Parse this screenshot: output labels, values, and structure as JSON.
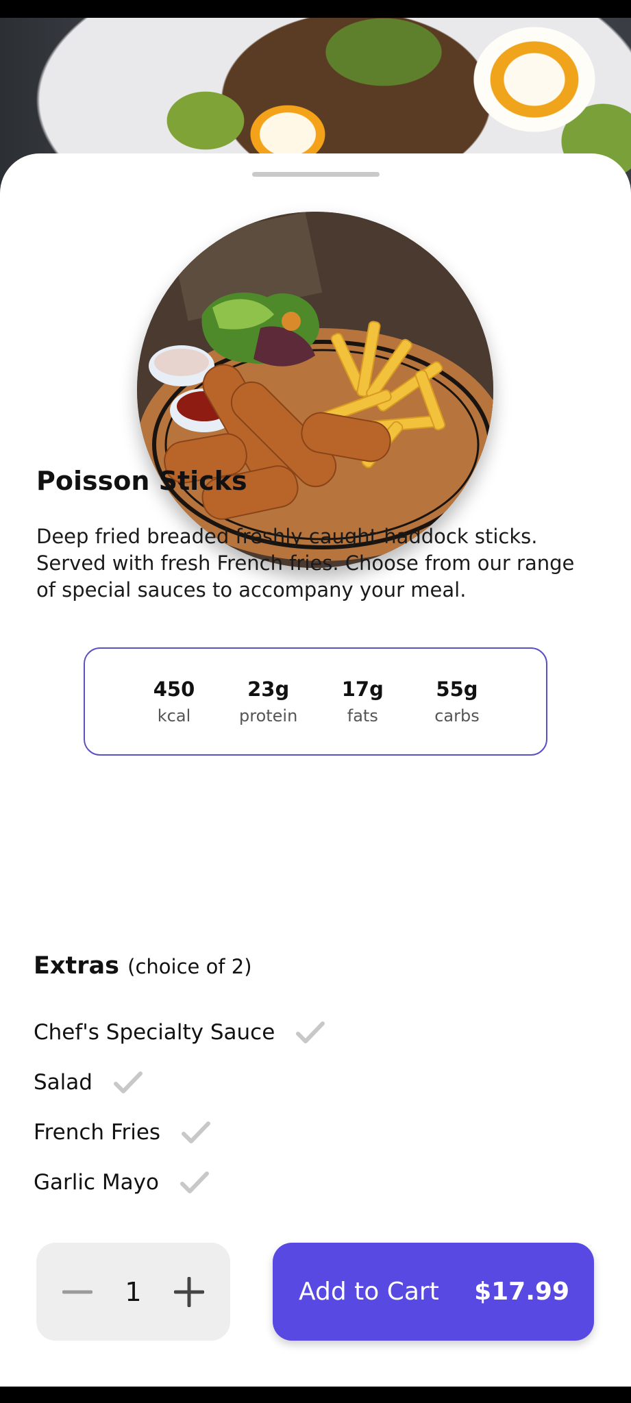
{
  "dish": {
    "title": "Poisson Sticks",
    "description": "Deep fried breaded freshly caught haddock sticks. Served with fresh French fries. Choose from our range of special sauces to accompany your meal."
  },
  "nutrition": [
    {
      "value": "450",
      "unit": "kcal"
    },
    {
      "value": "23g",
      "unit": "protein"
    },
    {
      "value": "17g",
      "unit": "fats"
    },
    {
      "value": "55g",
      "unit": "carbs"
    }
  ],
  "extras": {
    "heading": "Extras",
    "subheading": "(choice of 2)",
    "items": [
      {
        "label": "Chef's Specialty Sauce",
        "icon": "check-icon"
      },
      {
        "label": "Salad",
        "icon": "check-icon"
      },
      {
        "label": "French Fries",
        "icon": "check-icon"
      },
      {
        "label": "Garlic Mayo",
        "icon": "check-icon"
      }
    ]
  },
  "cart": {
    "quantity": "1",
    "add_label": "Add to Cart",
    "price": "$17.99",
    "minus_icon": "minus-icon",
    "plus_icon": "plus-icon"
  },
  "colors": {
    "accent": "#5849e2",
    "border": "#5b4fc4",
    "check": "#c8c8c8",
    "qty_bg": "#eeeeee"
  }
}
